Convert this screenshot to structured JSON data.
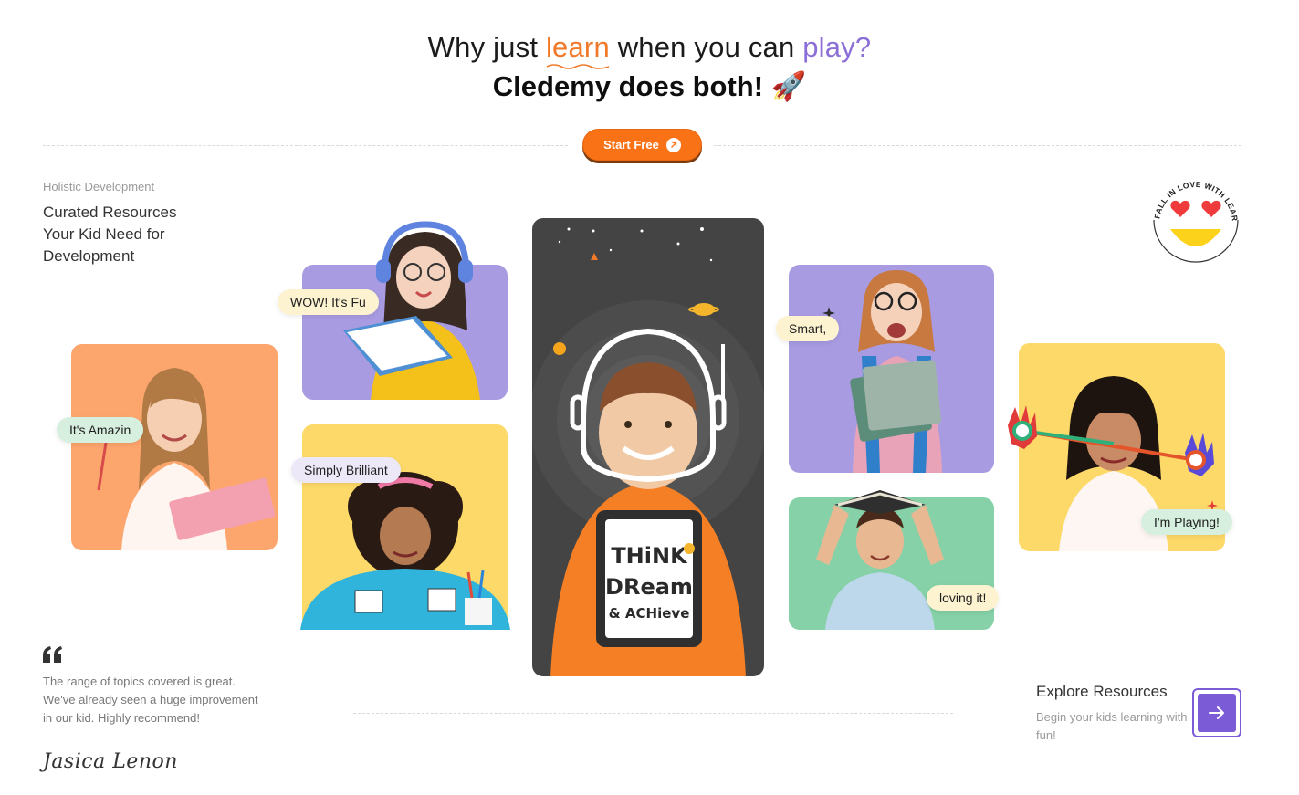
{
  "hero": {
    "line1_part1": "Why just ",
    "line1_highlight1": "learn",
    "line1_part2": " when you can ",
    "line1_highlight2": "play?",
    "line2": "Cledemy does both! 🚀"
  },
  "cta": {
    "start_label": "Start Free"
  },
  "intro": {
    "eyebrow": "Holistic Development",
    "heading": "Curated Resources Your Kid Need for Development"
  },
  "bubbles": {
    "fun": "WOW! It's Fu",
    "amazing": "It's Amazin",
    "brilliant": "Simply Brilliant",
    "smart": "Smart, ",
    "loving": "loving it!",
    "playing": "I'm Playing!"
  },
  "sign": {
    "line1": "THiNK",
    "line2": "DReam",
    "line3": "& ACHieve"
  },
  "badge": {
    "text": "FALL IN LOVE WITH LEARNING"
  },
  "testimonial": {
    "quote_mark": "“",
    "text": "The range of topics covered is great. We've already seen a huge improvement in our kid. Highly recommend!",
    "signature": "Jasica Lenon"
  },
  "explore": {
    "title": "Explore Resources",
    "subtitle": "Begin your kids learning with fun!"
  },
  "colors": {
    "orange": "#f97316",
    "purple": "#7c5cd6",
    "card_lilac": "#a99be2",
    "card_yellow": "#fcd968",
    "card_orange": "#fca56d",
    "card_green": "#86d1a8",
    "center_dark": "#444444"
  }
}
